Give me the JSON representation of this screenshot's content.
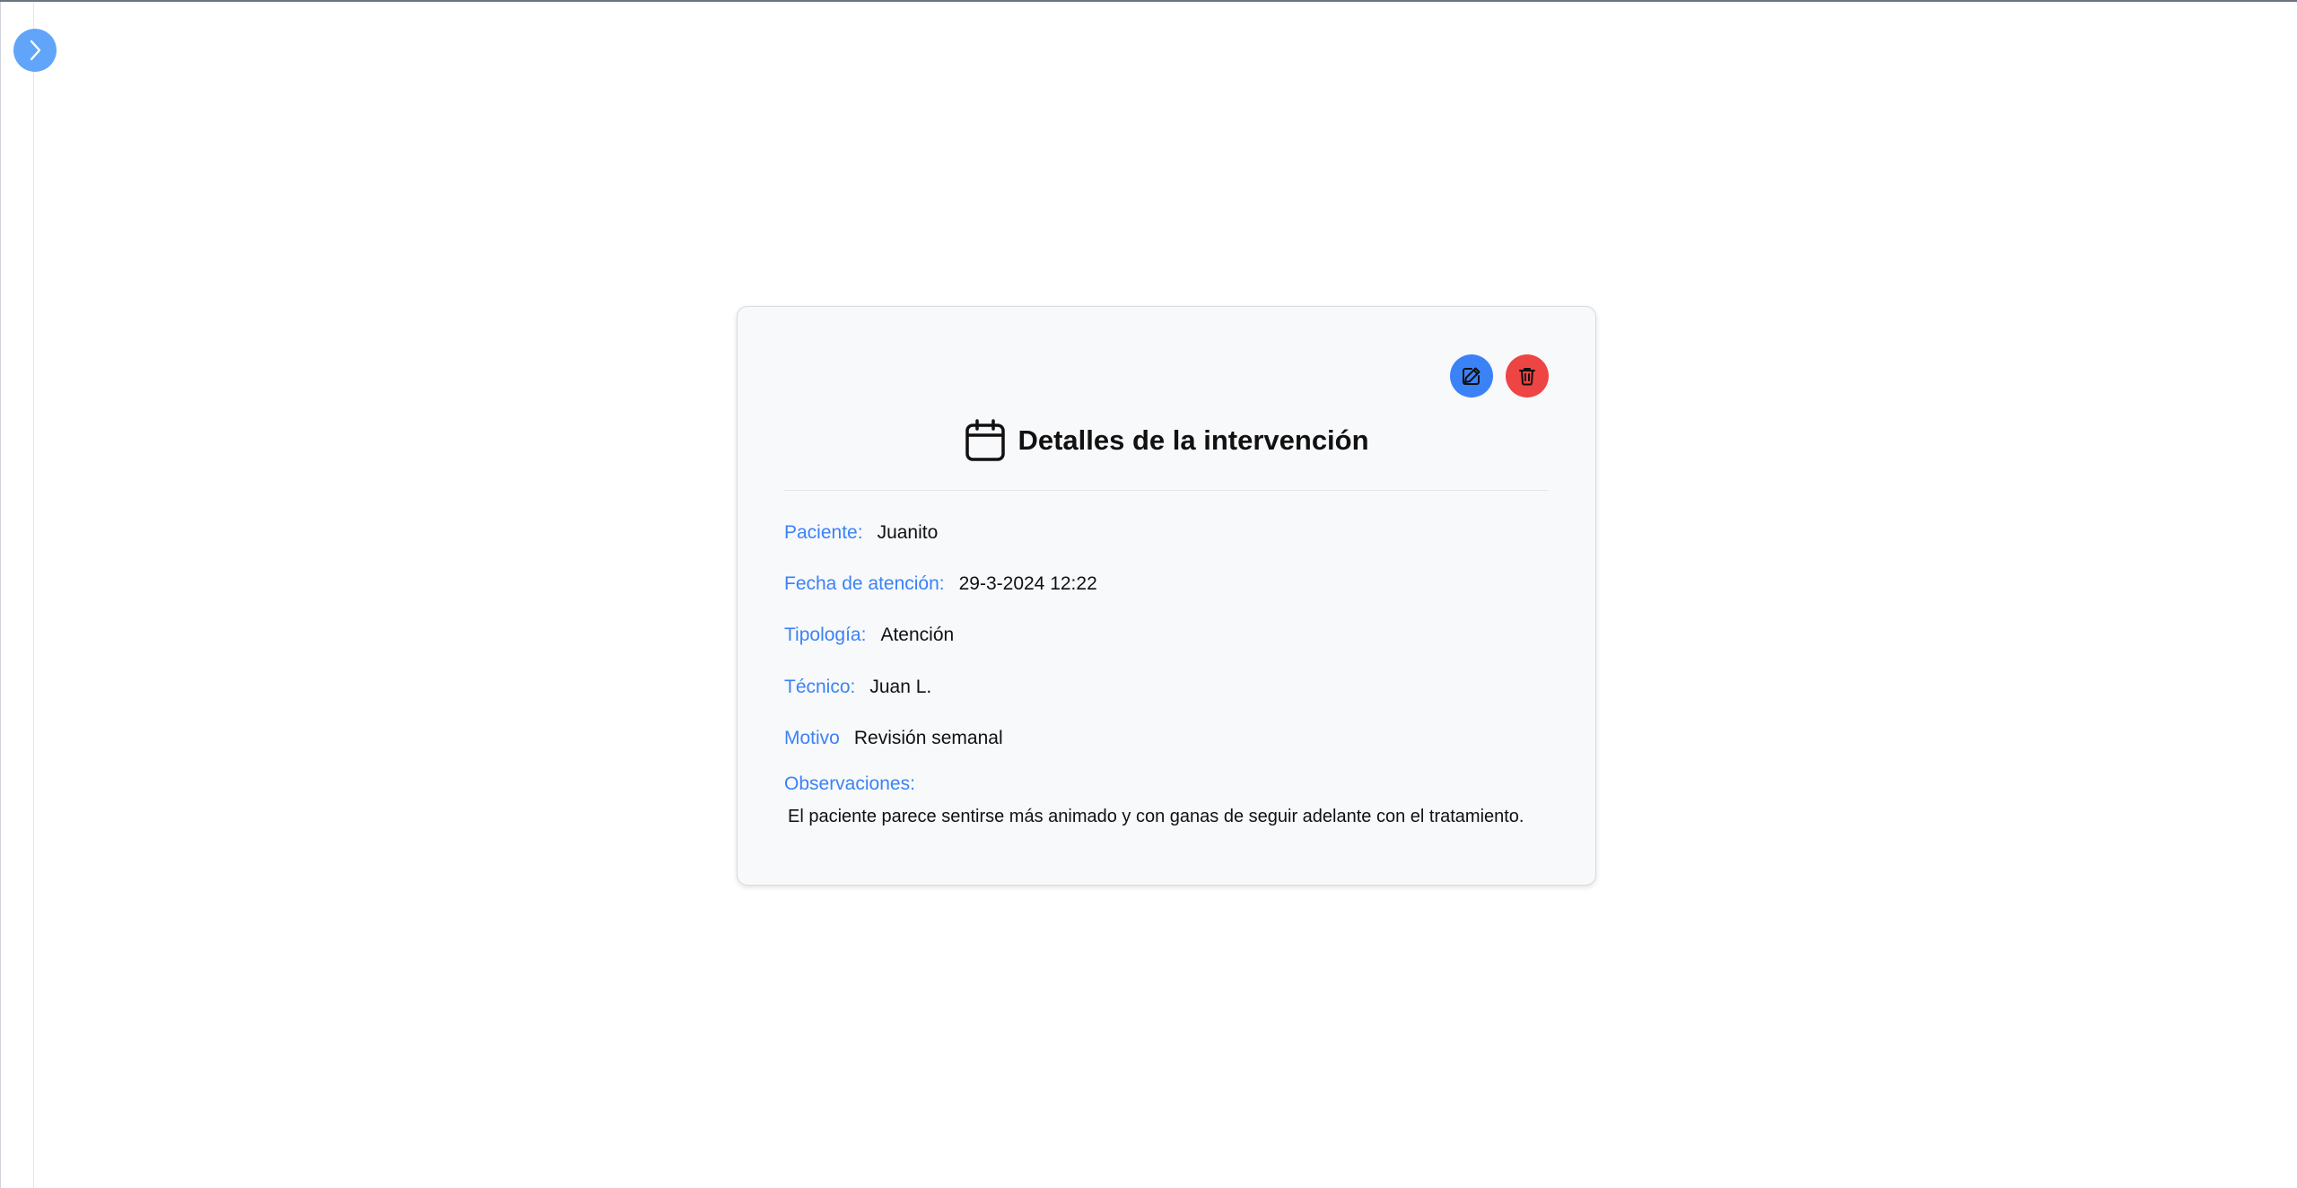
{
  "colors": {
    "accent": "#3b82f6",
    "sidebar_toggle": "#60a5fa",
    "delete": "#ef4444"
  },
  "sidebar": {
    "toggle_icon": "chevron-right-icon"
  },
  "card": {
    "title": "Detalles de la intervención",
    "title_icon": "calendar-icon",
    "actions": {
      "edit_icon": "pencil-square-icon",
      "delete_icon": "trash-icon"
    },
    "fields": {
      "patient": {
        "label": "Paciente:",
        "value": "Juanito"
      },
      "date": {
        "label": "Fecha de atención:",
        "value": "29-3-2024 12:22"
      },
      "type": {
        "label": "Tipología:",
        "value": "Atención"
      },
      "technician": {
        "label": "Técnico:",
        "value": "Juan L."
      },
      "reason": {
        "label": "Motivo",
        "value": "Revisión semanal"
      }
    },
    "observations": {
      "label": "Observaciones:",
      "text": "El paciente parece sentirse más animado y con ganas de seguir adelante con el tratamiento."
    }
  }
}
